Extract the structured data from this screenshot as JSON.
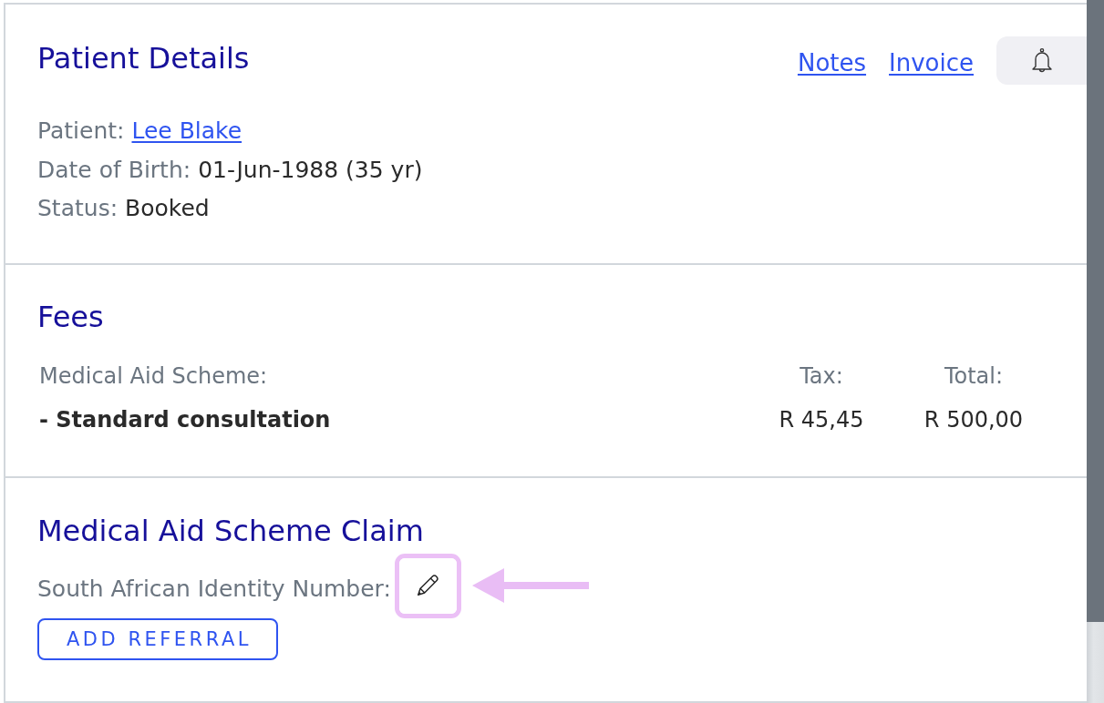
{
  "patient_details": {
    "title": "Patient Details",
    "links": [
      "Notes",
      "Invoice"
    ],
    "fields": [
      {
        "label": "Patient:",
        "value": "Lee Blake",
        "kind": "link"
      },
      {
        "label": "Date of Birth:",
        "value": "01-Jun-1988 (35 yr)",
        "kind": "text"
      },
      {
        "label": "Status:",
        "value": "Booked",
        "kind": "text"
      }
    ]
  },
  "fees": {
    "title": "Fees",
    "columns": [
      "Medical Aid Scheme:",
      "Tax:",
      "Total:"
    ],
    "rows": [
      [
        "- Standard consultation",
        "R 45,45",
        "R 500,00"
      ]
    ]
  },
  "claim": {
    "title": "Medical Aid Scheme Claim",
    "identity_number": {
      "label": "South African Identity Number:",
      "highlighted": true
    },
    "button": "ADD REFERRAL"
  }
}
